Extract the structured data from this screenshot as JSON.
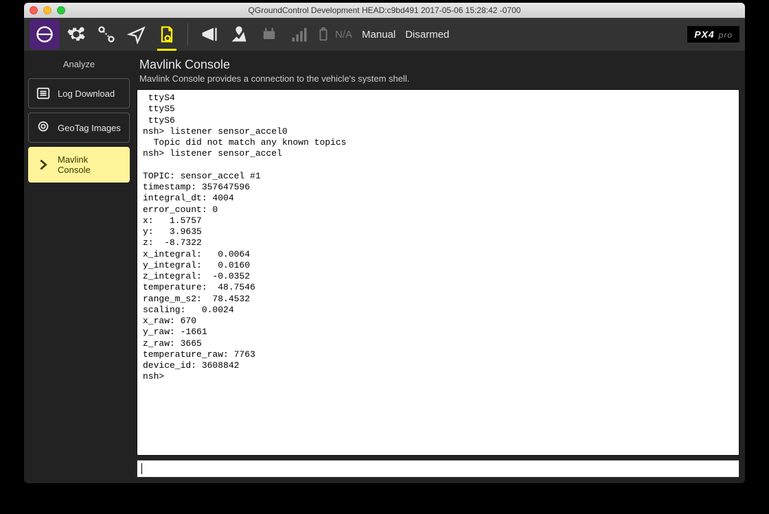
{
  "window": {
    "title": "QGroundControl Development HEAD:c9bd491 2017-05-06 15:28:42 -0700"
  },
  "toolbar": {
    "na_label": "N/A",
    "mode_label": "Manual",
    "armed_label": "Disarmed",
    "brand": "PX4",
    "brand_sub": "pro"
  },
  "sidebar": {
    "title": "Analyze",
    "items": [
      {
        "label": "Log Download"
      },
      {
        "label": "GeoTag Images"
      },
      {
        "label": "Mavlink Console"
      }
    ]
  },
  "page": {
    "title": "Mavlink Console",
    "subtitle": "Mavlink Console provides a connection to the vehicle's system shell."
  },
  "console_text": " ttyS4\n ttyS5\n ttyS6\nnsh> listener sensor_accel0\n  Topic did not match any known topics\nnsh> listener sensor_accel\n\nTOPIC: sensor_accel #1\ntimestamp: 357647596\nintegral_dt: 4004\nerror_count: 0\nx:   1.5757\ny:   3.9635\nz:  -8.7322\nx_integral:   0.0064\ny_integral:   0.0160\nz_integral:  -0.0352\ntemperature:  48.7546\nrange_m_s2:  78.4532\nscaling:   0.0024\nx_raw: 670\ny_raw: -1661\nz_raw: 3665\ntemperature_raw: 7763\ndevice_id: 3608842\nnsh> ",
  "command_input": {
    "value": ""
  }
}
